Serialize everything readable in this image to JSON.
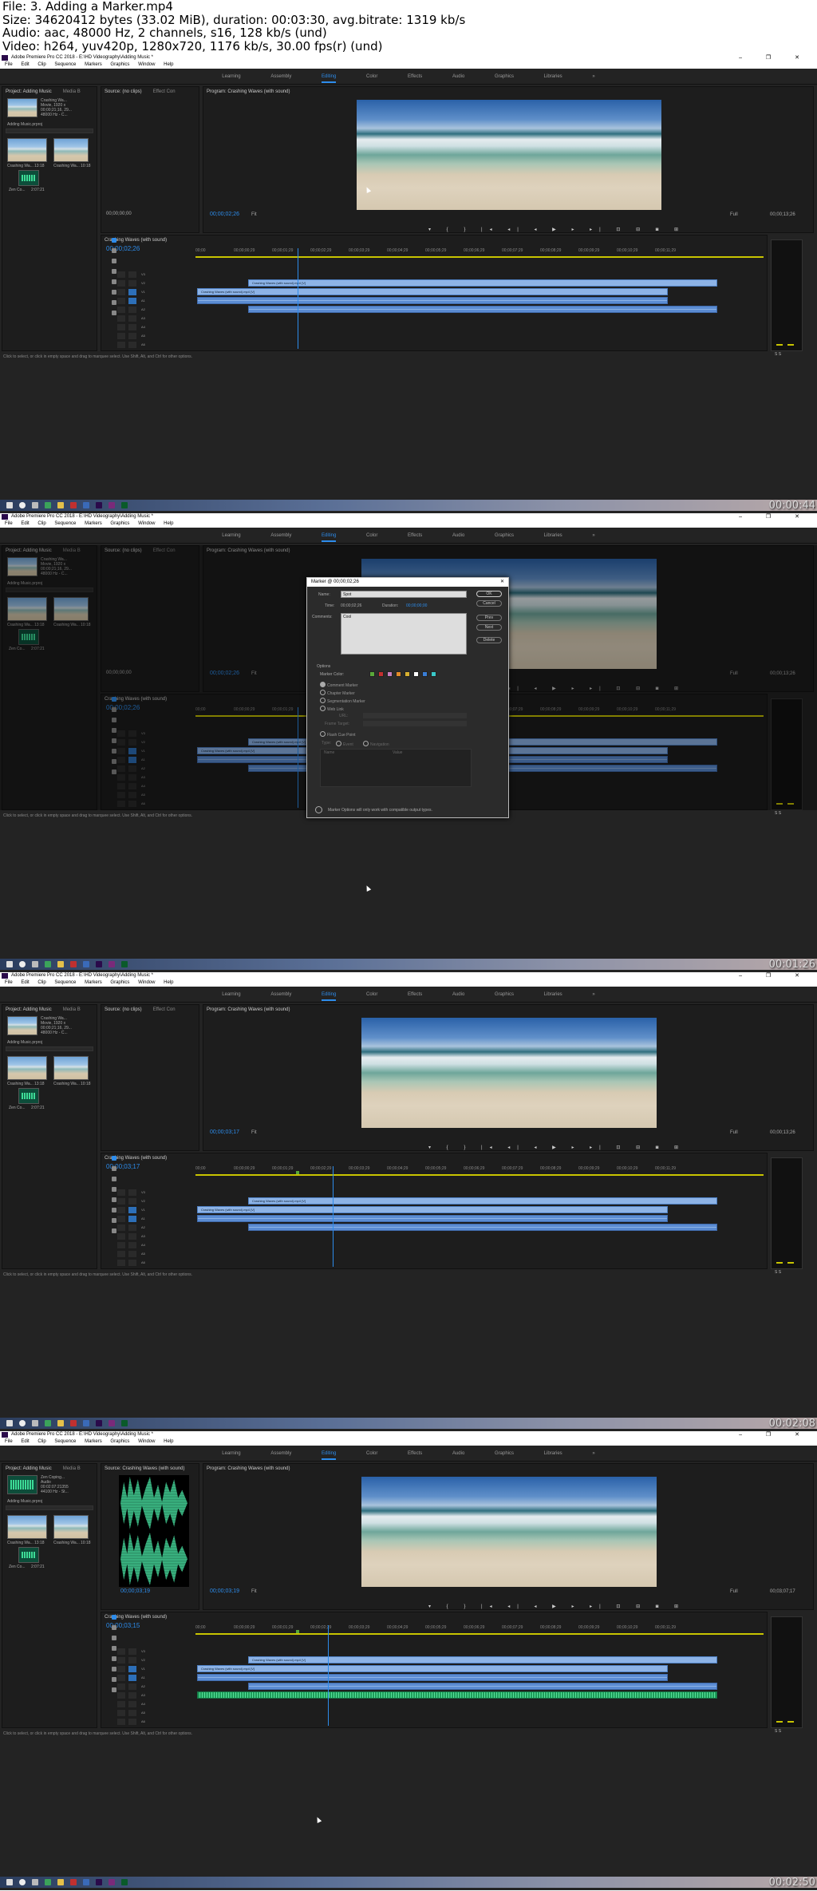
{
  "header": {
    "line1": "File: 3. Adding a Marker.mp4",
    "line2": "Size: 34620412 bytes (33.02 MiB), duration: 00:03:30, avg.bitrate: 1319 kb/s",
    "line3": "Audio: aac, 48000 Hz, 2 channels, s16, 128 kb/s (und)",
    "line4": "Video: h264, yuv420p, 1280x720, 1176 kb/s, 30.00 fps(r) (und)"
  },
  "app": {
    "title": "Adobe Premiere Pro CC 2018 - E:\\HD Videography\\Adding Music *",
    "window_controls": "–  ❐  ✕",
    "menu": [
      "File",
      "Edit",
      "Clip",
      "Sequence",
      "Markers",
      "Graphics",
      "Window",
      "Help"
    ],
    "workspaces": [
      "Learning",
      "Assembly",
      "Editing",
      "Color",
      "Effects",
      "Audio",
      "Graphics",
      "Libraries"
    ],
    "active_workspace": "Editing",
    "workspace_more": "»"
  },
  "panels": {
    "project_tab": "Project: Adding Music",
    "media_tab": "Media B",
    "source_tab_empty": "Source: (no clips)",
    "effect_controls_tab": "Effect Con",
    "source_tab_clip": "Source: Crashing Waves (with sound)",
    "program_tab": "Program: Crashing Waves (with sound)",
    "project_file": "Adding Music.prproj",
    "clip_info_name": "Crashing Wa...",
    "clip_info_video": "Movie, 1920 x",
    "clip_info_date": "00;00;21;16, 29...",
    "clip_info_audio": "48000 Hz - C...",
    "audio_info_name": "Zen Coping...",
    "audio_info_type": "Audio",
    "audio_info_dur": "00:02:07:21355",
    "audio_info_rate": "44100 Hz - St...",
    "thumb_label_1": "Crashing Wa...",
    "thumb_label_2": "Crashing Wa...",
    "thumb_dur_1": "13:18",
    "thumb_dur_2": "10:18",
    "audio_thumb_label": "Zen Co...",
    "audio_thumb_dur": "2:07:21",
    "sequence_tab": "Crashing Waves (with sound)",
    "fit": "Fit",
    "full": "Full",
    "master": "Master",
    "status_text": "Click to select, or click in empty space and drag to marquee select. Use Shift, Alt, and Ctrl for other options.",
    "meter_labels": "S  S"
  },
  "timeline": {
    "ruler": [
      "00;00",
      "00;00;00;29",
      "00;00;01;29",
      "00;00;02;29",
      "00;00;03;29",
      "00;00;04;29",
      "00;00;05;29",
      "00;00;06;29",
      "00;00;07;29",
      "00;00;08;29",
      "00;00;09;29",
      "00;00;10;29",
      "00;00;11;29"
    ],
    "clip_v2": "Crashing Waves (with sound).mp4 [V]",
    "clip_v1": "Crashing Waves (with sound).mp4 [V]",
    "tracks_video": [
      "V3",
      "V2",
      "V1"
    ],
    "tracks_audio": [
      "A1",
      "A2",
      "A3",
      "A4",
      "A5",
      "A6"
    ]
  },
  "frames": [
    {
      "source_tc": "00;00;00;00",
      "program_tc": "00;00;02;26",
      "duration_tc": "00;00;13;26",
      "timeline_tc": "00;00;02;26",
      "timestamp": "00:00:44"
    },
    {
      "source_tc": "00;00;00;00",
      "program_tc": "00;00;02;26",
      "duration_tc": "00;00;13;26",
      "timeline_tc": "00;00;02;26",
      "timestamp": "00:01:26"
    },
    {
      "source_tc": "",
      "program_tc": "00;00;03;17",
      "duration_tc": "00;00;13;26",
      "timeline_tc": "00;00;03;17",
      "timestamp": "00:02:08"
    },
    {
      "source_tc": "00;00;03;19",
      "program_tc": "00;00;03;19",
      "duration_tc": "00;03;07;17",
      "timeline_tc": "00;00;03;15",
      "timestamp": "00:02:50"
    }
  ],
  "marker_dialog": {
    "title": "Marker @ 00;00;02;26",
    "close": "✕",
    "name_label": "Name:",
    "name_value": "Spot",
    "time_label": "Time:",
    "time_value": "00;00;02;26",
    "duration_label": "Duration:",
    "duration_value": "00;00;00;00",
    "comments_label": "Comments:",
    "comments_value": "Cool",
    "ok": "OK",
    "cancel": "Cancel",
    "prev": "Prev",
    "next": "Next",
    "delete": "Delete",
    "options_label": "Options",
    "marker_color_label": "Marker Color:",
    "marker_colors": [
      "#5aa83a",
      "#c43030",
      "#c480c0",
      "#e28a28",
      "#d8b030",
      "#ffffff",
      "#3a7ed6",
      "#3ac8c8"
    ],
    "radio_comment": "Comment Marker",
    "radio_chapter": "Chapter Marker",
    "radio_segmentation": "Segmentation Marker",
    "radio_weblink": "Web Link",
    "radio_flash": "Flash Cue Point",
    "url_label": "URL:",
    "frame_target_label": "Frame Target:",
    "type_label": "Type:",
    "event_label": "Event",
    "navigation_label": "Navigation",
    "param_name": "Name",
    "param_value": "Value",
    "footer": "Marker Options will only work with compatible output types."
  }
}
